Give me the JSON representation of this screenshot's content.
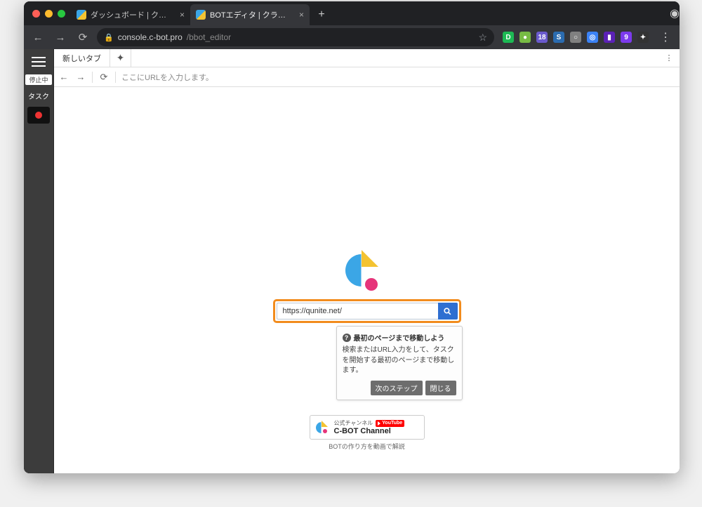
{
  "browser": {
    "tabs": [
      {
        "label": "ダッシュボード | クラウドBOT",
        "active": false
      },
      {
        "label": "BOTエディタ | クラウドBOT",
        "active": true
      }
    ],
    "url_host": "console.c-bot.pro",
    "url_path": "/bbot_editor"
  },
  "rail": {
    "status_label": "停止中",
    "task_label": "タスク"
  },
  "inner": {
    "tab_label": "新しいタブ",
    "url_placeholder": "ここにURLを入力します。"
  },
  "search": {
    "value": "https://qunite.net/"
  },
  "tip": {
    "title": "最初のページまで移動しよう",
    "body": "検索またはURL入力をして、タスクを開始する最初のページまで移動します。",
    "next": "次のステップ",
    "close": "閉じる"
  },
  "yt": {
    "official": "公式チャンネル",
    "youtube": "YouTube",
    "channel": "C-BOT Channel",
    "caption": "BOTの作り方を動画で解説"
  }
}
